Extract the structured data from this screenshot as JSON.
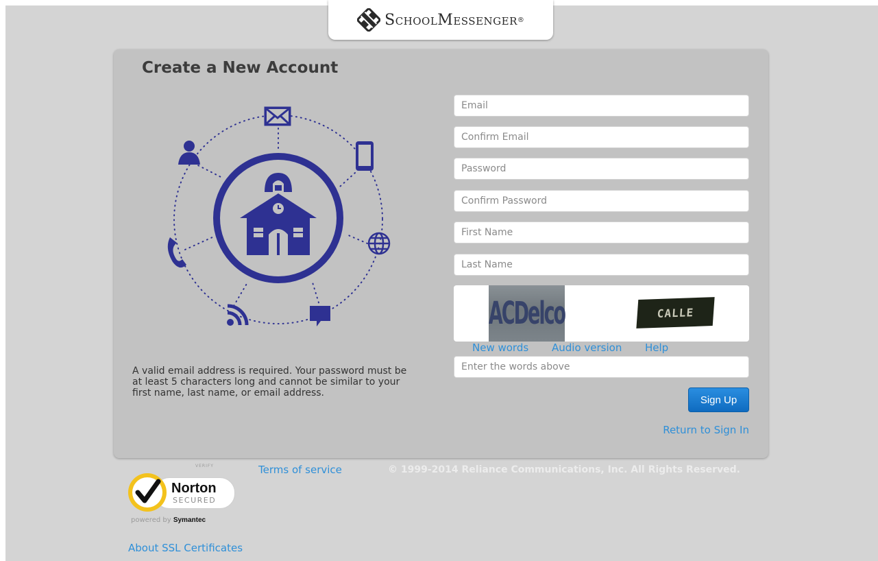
{
  "header": {
    "logo_text": "SchoolMessenger",
    "logo_registered": "®"
  },
  "form": {
    "title": "Create a New Account",
    "fields": {
      "email": "Email",
      "confirm_email": "Confirm Email",
      "password": "Password",
      "confirm_password": "Confirm Password",
      "first_name": "First Name",
      "last_name": "Last Name"
    },
    "captcha": {
      "word1": "ACDelco",
      "word2": "CALLE",
      "new_words": "New words",
      "audio_version": "Audio version",
      "help": "Help",
      "input_placeholder": "Enter the words above"
    },
    "submit_label": "Sign Up",
    "return_link": "Return to Sign In",
    "info_text": "A valid email address is required. Your password must be at least 5 characters long and cannot be similar to your first name, last name, or email address."
  },
  "footer": {
    "norton": {
      "verify": "VERIFY",
      "name": "Norton",
      "secured": "SECURED",
      "powered_prefix": "powered by",
      "powered_brand": "Symantec"
    },
    "terms_link": "Terms of service",
    "copyright": "© 1999-2014 Reliance Communications, Inc. All Rights Reserved.",
    "ssl_link": "About SSL Certificates"
  },
  "colors": {
    "accent": "#2e3192",
    "link": "#2e8fd8",
    "button": "#1a7fd4",
    "panel": "#c2c2c2",
    "background": "#d4d4d4",
    "norton_yellow": "#f3c21d"
  },
  "icons": [
    "logo-icon",
    "envelope-icon",
    "smartphone-icon",
    "user-icon",
    "schoolhouse-icon",
    "phone-icon",
    "globe-icon",
    "rss-icon",
    "chat-bubble-icon",
    "norton-checkmark-icon"
  ]
}
